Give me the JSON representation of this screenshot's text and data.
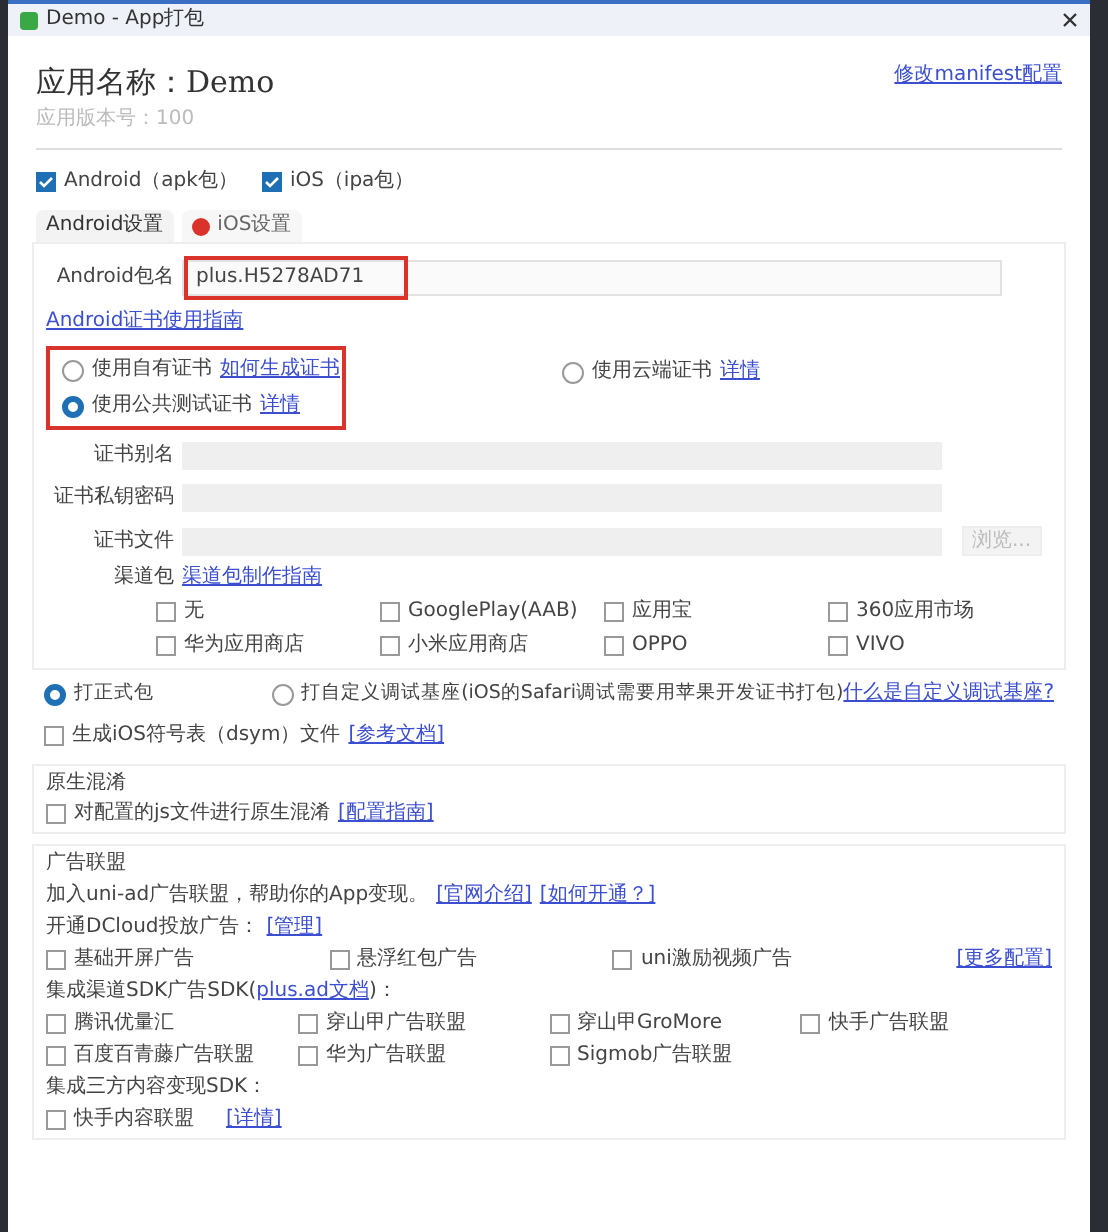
{
  "window": {
    "title": "Demo - App打包"
  },
  "app": {
    "name": "应用名称：Demo",
    "version": "应用版本号：100",
    "manifest_link": "修改manifest配置"
  },
  "platforms": [
    {
      "label": "Android（apk包）",
      "checked": true
    },
    {
      "label": "iOS（ipa包）",
      "checked": true
    }
  ],
  "tabs": [
    {
      "label": "Android设置",
      "selected": true,
      "error": false
    },
    {
      "label": "iOS设置",
      "selected": false,
      "error": true
    }
  ],
  "package": {
    "label": "Android包名",
    "value": "plus.H5278AD71",
    "highlighted": true
  },
  "cert_guide": "Android证书使用指南",
  "cert_options": [
    {
      "label": "使用自有证书",
      "link": "如何生成证书",
      "selected": false,
      "highlighted": true
    },
    {
      "label": "使用云端证书",
      "link": "详情",
      "selected": false,
      "highlighted": false
    },
    {
      "label": "使用公共测试证书",
      "link": "详情",
      "selected": true,
      "highlighted": true
    }
  ],
  "cert_fields": [
    {
      "label": "证书别名"
    },
    {
      "label": "证书私钥密码"
    },
    {
      "label": "证书文件",
      "button": "浏览..."
    }
  ],
  "channels": {
    "label": "渠道包",
    "link": "渠道包制作指南",
    "items": [
      {
        "label": "无",
        "checked": false
      },
      {
        "label": "GooglePlay(AAB)",
        "checked": false
      },
      {
        "label": "应用宝",
        "checked": false
      },
      {
        "label": "360应用市场",
        "checked": false
      },
      {
        "label": "华为应用商店",
        "checked": false
      },
      {
        "label": "小米应用商店",
        "checked": false
      },
      {
        "label": "OPPO",
        "checked": false
      },
      {
        "label": "VIVO",
        "checked": false
      }
    ]
  },
  "build_type": {
    "options": [
      {
        "label": "打正式包",
        "selected": true
      },
      {
        "label": "打自定义调试基座(iOS的Safari调试需要用苹果开发证书打包)",
        "selected": false
      }
    ],
    "link": "什么是自定义调试基座?"
  },
  "dsym": {
    "label": "生成iOS符号表（dsym）文件",
    "checked": false,
    "link": "[参考文档]"
  },
  "obfuscation": {
    "title": "原生混淆",
    "label": "对配置的js文件进行原生混淆",
    "checked": false,
    "link": "[配置指南]"
  },
  "ads": {
    "title": "广告联盟",
    "intro": "加入uni-ad广告联盟，帮助你的App变现。",
    "intro_links": [
      "[官网介绍]",
      "[如何开通？]"
    ],
    "dcloud": {
      "label": "开通DCloud投放广告：",
      "link": "[管理]"
    },
    "dcloud_items": [
      {
        "label": "基础开屏广告",
        "checked": false
      },
      {
        "label": "悬浮红包广告",
        "checked": false
      },
      {
        "label": "uni激励视频广告",
        "checked": false
      }
    ],
    "more_link": "[更多配置]",
    "sdk": {
      "before": "集成渠道SDK广告SDK(",
      "link": "plus.ad文档",
      "after": ")："
    },
    "sdk_items": [
      {
        "label": "腾讯优量汇",
        "checked": false
      },
      {
        "label": "穿山甲广告联盟",
        "checked": false
      },
      {
        "label": "穿山甲GroMore",
        "checked": false
      },
      {
        "label": "快手广告联盟",
        "checked": false
      },
      {
        "label": "百度百青藤广告联盟",
        "checked": false
      },
      {
        "label": "华为广告联盟",
        "checked": false
      },
      {
        "label": "Sigmob广告联盟",
        "checked": false
      }
    ],
    "content_label": "集成三方内容变现SDK：",
    "content_items": [
      {
        "label": "快手内容联盟",
        "checked": false,
        "link": "[详情]"
      }
    ]
  }
}
